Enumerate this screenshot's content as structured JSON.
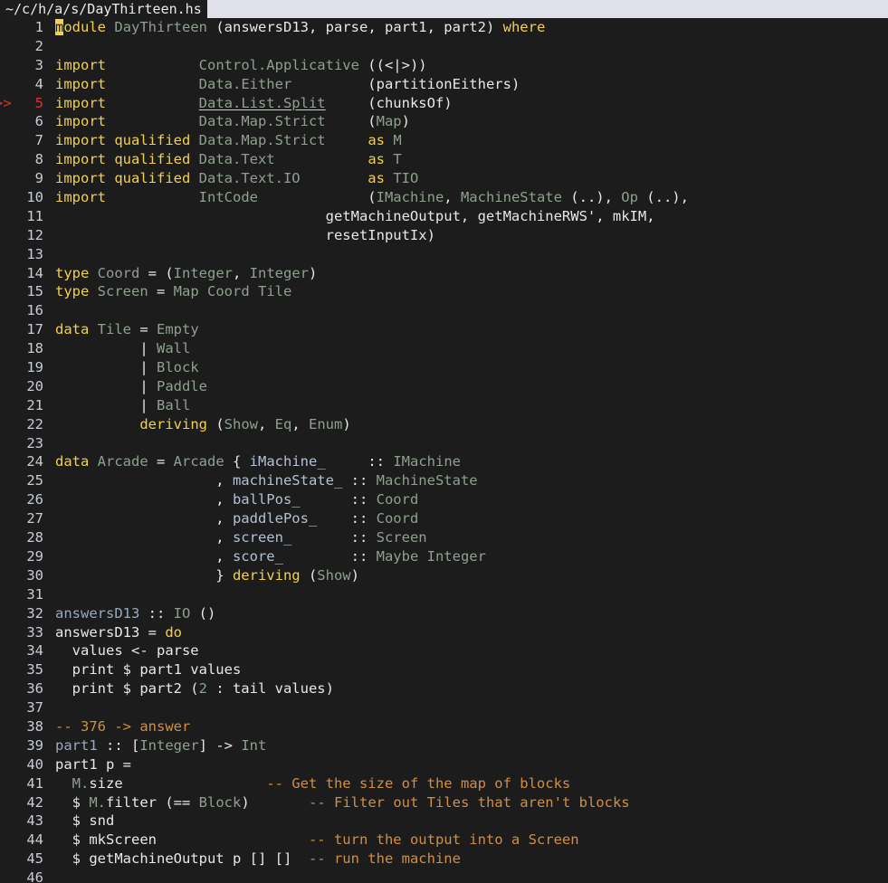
{
  "titlebar": {
    "tab_label": "~/c/h/a/s/DayThirteen.hs",
    "tab_bg": "#1c1c1c",
    "bar_bg": "#dfe0ea"
  },
  "editor": {
    "background": "#1c1c1c",
    "error_marker": ">>",
    "error_line": 5,
    "cursor_line": 1,
    "cursor_char": "m",
    "colors": {
      "keyword": "#f2d14b",
      "type": "#8fa08f",
      "function": "#9aa8bd",
      "field": "#b4c1d4",
      "number": "#7fa88c",
      "comment": "#d08f44",
      "plain": "#e8e8e8",
      "error": "#e03030",
      "linenumber": "#c8ccd4"
    },
    "lines": [
      {
        "n": "1",
        "tokens": [
          {
            "t": "module",
            "c": "kw",
            "cursor": 1
          },
          {
            "t": " ",
            "c": "plain"
          },
          {
            "t": "DayThirteen",
            "c": "typ"
          },
          {
            "t": " (answersD13, parse, part1, part2) ",
            "c": "plain"
          },
          {
            "t": "where",
            "c": "kw"
          }
        ]
      },
      {
        "n": "2",
        "tokens": []
      },
      {
        "n": "3",
        "tokens": [
          {
            "t": "import",
            "c": "kw"
          },
          {
            "t": "           ",
            "c": "plain"
          },
          {
            "t": "Control.Applicative",
            "c": "typ"
          },
          {
            "t": " ((<|>))",
            "c": "plain"
          }
        ]
      },
      {
        "n": "4",
        "tokens": [
          {
            "t": "import",
            "c": "kw"
          },
          {
            "t": "           ",
            "c": "plain"
          },
          {
            "t": "Data.Either",
            "c": "typ"
          },
          {
            "t": "         (partitionEithers)",
            "c": "plain"
          }
        ]
      },
      {
        "n": "5",
        "tokens": [
          {
            "t": "import",
            "c": "kw"
          },
          {
            "t": "           ",
            "c": "plain"
          },
          {
            "t": "Data.List.Split",
            "c": "typ",
            "underline": true
          },
          {
            "t": "     (chunksOf)",
            "c": "plain"
          }
        ],
        "error": true
      },
      {
        "n": "6",
        "tokens": [
          {
            "t": "import",
            "c": "kw"
          },
          {
            "t": "           ",
            "c": "plain"
          },
          {
            "t": "Data.Map.Strict",
            "c": "typ"
          },
          {
            "t": "     (",
            "c": "plain"
          },
          {
            "t": "Map",
            "c": "typ"
          },
          {
            "t": ")",
            "c": "plain"
          }
        ]
      },
      {
        "n": "7",
        "tokens": [
          {
            "t": "import qualified",
            "c": "kw"
          },
          {
            "t": " ",
            "c": "plain"
          },
          {
            "t": "Data.Map.Strict",
            "c": "typ"
          },
          {
            "t": "     ",
            "c": "plain"
          },
          {
            "t": "as",
            "c": "kw"
          },
          {
            "t": " ",
            "c": "plain"
          },
          {
            "t": "M",
            "c": "typ"
          }
        ]
      },
      {
        "n": "8",
        "tokens": [
          {
            "t": "import qualified",
            "c": "kw"
          },
          {
            "t": " ",
            "c": "plain"
          },
          {
            "t": "Data.Text",
            "c": "typ"
          },
          {
            "t": "           ",
            "c": "plain"
          },
          {
            "t": "as",
            "c": "kw"
          },
          {
            "t": " ",
            "c": "plain"
          },
          {
            "t": "T",
            "c": "typ"
          }
        ]
      },
      {
        "n": "9",
        "tokens": [
          {
            "t": "import qualified",
            "c": "kw"
          },
          {
            "t": " ",
            "c": "plain"
          },
          {
            "t": "Data.Text.IO",
            "c": "typ"
          },
          {
            "t": "        ",
            "c": "plain"
          },
          {
            "t": "as",
            "c": "kw"
          },
          {
            "t": " ",
            "c": "plain"
          },
          {
            "t": "TIO",
            "c": "typ"
          }
        ]
      },
      {
        "n": "10",
        "tokens": [
          {
            "t": "import",
            "c": "kw"
          },
          {
            "t": "           ",
            "c": "plain"
          },
          {
            "t": "IntCode",
            "c": "typ"
          },
          {
            "t": "             (",
            "c": "plain"
          },
          {
            "t": "IMachine",
            "c": "typ"
          },
          {
            "t": ", ",
            "c": "plain"
          },
          {
            "t": "MachineState",
            "c": "typ"
          },
          {
            "t": " (..), ",
            "c": "plain"
          },
          {
            "t": "Op",
            "c": "typ"
          },
          {
            "t": " (..),",
            "c": "plain"
          }
        ]
      },
      {
        "n": "11",
        "tokens": [
          {
            "t": "                                getMachineOutput, getMachineRWS', mkIM,",
            "c": "plain"
          }
        ]
      },
      {
        "n": "12",
        "tokens": [
          {
            "t": "                                resetInputIx)",
            "c": "plain"
          }
        ]
      },
      {
        "n": "13",
        "tokens": []
      },
      {
        "n": "14",
        "tokens": [
          {
            "t": "type",
            "c": "kw"
          },
          {
            "t": " ",
            "c": "plain"
          },
          {
            "t": "Coord",
            "c": "typ"
          },
          {
            "t": " = (",
            "c": "plain"
          },
          {
            "t": "Integer",
            "c": "typ"
          },
          {
            "t": ", ",
            "c": "plain"
          },
          {
            "t": "Integer",
            "c": "typ"
          },
          {
            "t": ")",
            "c": "plain"
          }
        ]
      },
      {
        "n": "15",
        "tokens": [
          {
            "t": "type",
            "c": "kw"
          },
          {
            "t": " ",
            "c": "plain"
          },
          {
            "t": "Screen",
            "c": "typ"
          },
          {
            "t": " = ",
            "c": "plain"
          },
          {
            "t": "Map Coord Tile",
            "c": "typ"
          }
        ]
      },
      {
        "n": "16",
        "tokens": []
      },
      {
        "n": "17",
        "tokens": [
          {
            "t": "data",
            "c": "kw"
          },
          {
            "t": " ",
            "c": "plain"
          },
          {
            "t": "Tile",
            "c": "typ"
          },
          {
            "t": " = ",
            "c": "plain"
          },
          {
            "t": "Empty",
            "c": "typ"
          }
        ]
      },
      {
        "n": "18",
        "tokens": [
          {
            "t": "          | ",
            "c": "plain"
          },
          {
            "t": "Wall",
            "c": "typ"
          }
        ]
      },
      {
        "n": "19",
        "tokens": [
          {
            "t": "          | ",
            "c": "plain"
          },
          {
            "t": "Block",
            "c": "typ"
          }
        ]
      },
      {
        "n": "20",
        "tokens": [
          {
            "t": "          | ",
            "c": "plain"
          },
          {
            "t": "Paddle",
            "c": "typ"
          }
        ]
      },
      {
        "n": "21",
        "tokens": [
          {
            "t": "          | ",
            "c": "plain"
          },
          {
            "t": "Ball",
            "c": "typ"
          }
        ]
      },
      {
        "n": "22",
        "tokens": [
          {
            "t": "          ",
            "c": "plain"
          },
          {
            "t": "deriving",
            "c": "kw"
          },
          {
            "t": " (",
            "c": "plain"
          },
          {
            "t": "Show",
            "c": "typ"
          },
          {
            "t": ", ",
            "c": "plain"
          },
          {
            "t": "Eq",
            "c": "typ"
          },
          {
            "t": ", ",
            "c": "plain"
          },
          {
            "t": "Enum",
            "c": "typ"
          },
          {
            "t": ")",
            "c": "plain"
          }
        ]
      },
      {
        "n": "23",
        "tokens": []
      },
      {
        "n": "24",
        "tokens": [
          {
            "t": "data",
            "c": "kw"
          },
          {
            "t": " ",
            "c": "plain"
          },
          {
            "t": "Arcade",
            "c": "typ"
          },
          {
            "t": " = ",
            "c": "plain"
          },
          {
            "t": "Arcade",
            "c": "typ"
          },
          {
            "t": " { ",
            "c": "plain"
          },
          {
            "t": "iMachine_",
            "c": "fld"
          },
          {
            "t": "     :: ",
            "c": "plain"
          },
          {
            "t": "IMachine",
            "c": "typ"
          }
        ]
      },
      {
        "n": "25",
        "tokens": [
          {
            "t": "                   , ",
            "c": "plain"
          },
          {
            "t": "machineState_",
            "c": "fld"
          },
          {
            "t": " :: ",
            "c": "plain"
          },
          {
            "t": "MachineState",
            "c": "typ"
          }
        ]
      },
      {
        "n": "26",
        "tokens": [
          {
            "t": "                   , ",
            "c": "plain"
          },
          {
            "t": "ballPos_",
            "c": "fld"
          },
          {
            "t": "      :: ",
            "c": "plain"
          },
          {
            "t": "Coord",
            "c": "typ"
          }
        ]
      },
      {
        "n": "27",
        "tokens": [
          {
            "t": "                   , ",
            "c": "plain"
          },
          {
            "t": "paddlePos_",
            "c": "fld"
          },
          {
            "t": "    :: ",
            "c": "plain"
          },
          {
            "t": "Coord",
            "c": "typ"
          }
        ]
      },
      {
        "n": "28",
        "tokens": [
          {
            "t": "                   , ",
            "c": "plain"
          },
          {
            "t": "screen_",
            "c": "fld"
          },
          {
            "t": "       :: ",
            "c": "plain"
          },
          {
            "t": "Screen",
            "c": "typ"
          }
        ]
      },
      {
        "n": "29",
        "tokens": [
          {
            "t": "                   , ",
            "c": "plain"
          },
          {
            "t": "score_",
            "c": "fld"
          },
          {
            "t": "        :: ",
            "c": "plain"
          },
          {
            "t": "Maybe Integer",
            "c": "typ"
          }
        ]
      },
      {
        "n": "30",
        "tokens": [
          {
            "t": "                   } ",
            "c": "plain"
          },
          {
            "t": "deriving",
            "c": "kw"
          },
          {
            "t": " (",
            "c": "plain"
          },
          {
            "t": "Show",
            "c": "typ"
          },
          {
            "t": ")",
            "c": "plain"
          }
        ]
      },
      {
        "n": "31",
        "tokens": []
      },
      {
        "n": "32",
        "tokens": [
          {
            "t": "answersD13",
            "c": "fn"
          },
          {
            "t": " :: ",
            "c": "plain"
          },
          {
            "t": "IO",
            "c": "typ"
          },
          {
            "t": " ()",
            "c": "plain"
          }
        ]
      },
      {
        "n": "33",
        "tokens": [
          {
            "t": "answersD13 = ",
            "c": "plain"
          },
          {
            "t": "do",
            "c": "kw"
          }
        ]
      },
      {
        "n": "34",
        "tokens": [
          {
            "t": "  values <- parse",
            "c": "plain"
          }
        ]
      },
      {
        "n": "35",
        "tokens": [
          {
            "t": "  print $ part1 values",
            "c": "plain"
          }
        ]
      },
      {
        "n": "36",
        "tokens": [
          {
            "t": "  print $ part2 (",
            "c": "plain"
          },
          {
            "t": "2",
            "c": "num"
          },
          {
            "t": " : tail values)",
            "c": "plain"
          }
        ]
      },
      {
        "n": "37",
        "tokens": []
      },
      {
        "n": "38",
        "tokens": [
          {
            "t": "-- 376 -> answer",
            "c": "cmt"
          }
        ]
      },
      {
        "n": "39",
        "tokens": [
          {
            "t": "part1",
            "c": "fn"
          },
          {
            "t": " :: [",
            "c": "plain"
          },
          {
            "t": "Integer",
            "c": "typ"
          },
          {
            "t": "] -> ",
            "c": "plain"
          },
          {
            "t": "Int",
            "c": "typ"
          }
        ]
      },
      {
        "n": "40",
        "tokens": [
          {
            "t": "part1 p =",
            "c": "plain"
          }
        ]
      },
      {
        "n": "41",
        "tokens": [
          {
            "t": "  ",
            "c": "plain"
          },
          {
            "t": "M.",
            "c": "typ"
          },
          {
            "t": "size",
            "c": "plain"
          },
          {
            "t": "                 ",
            "c": "plain"
          },
          {
            "t": "-- Get the size of the map of blocks",
            "c": "cmt"
          }
        ]
      },
      {
        "n": "42",
        "tokens": [
          {
            "t": "  $ ",
            "c": "plain"
          },
          {
            "t": "M.",
            "c": "typ"
          },
          {
            "t": "filter (== ",
            "c": "plain"
          },
          {
            "t": "Block",
            "c": "typ"
          },
          {
            "t": ")",
            "c": "plain"
          },
          {
            "t": "       ",
            "c": "plain"
          },
          {
            "t": "-- Filter out Tiles that aren't blocks",
            "c": "cmt"
          }
        ]
      },
      {
        "n": "43",
        "tokens": [
          {
            "t": "  $ snd",
            "c": "plain"
          }
        ]
      },
      {
        "n": "44",
        "tokens": [
          {
            "t": "  $ mkScreen",
            "c": "plain"
          },
          {
            "t": "                  ",
            "c": "plain"
          },
          {
            "t": "-- turn the output into a Screen",
            "c": "cmt"
          }
        ]
      },
      {
        "n": "45",
        "tokens": [
          {
            "t": "  $ getMachineOutput p [] []",
            "c": "plain"
          },
          {
            "t": "  ",
            "c": "plain"
          },
          {
            "t": "-- run the machine",
            "c": "cmt"
          }
        ]
      },
      {
        "n": "46",
        "tokens": []
      }
    ]
  }
}
